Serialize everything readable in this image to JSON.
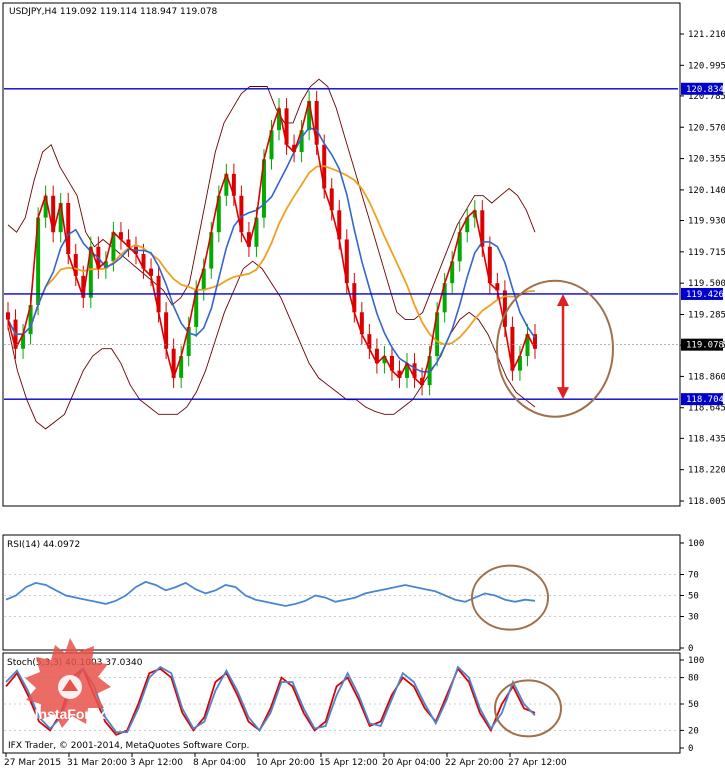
{
  "chart_data": [
    {
      "type": "line",
      "title": "USDJPY,H4  119.092 119.114 118.947 119.078",
      "ylim": [
        118.005,
        121.35
      ],
      "y_ticks": [
        "121.210",
        "120.995",
        "120.785",
        "120.570",
        "120.355",
        "120.140",
        "119.930",
        "119.715",
        "119.500",
        "119.285",
        "119.075",
        "118.860",
        "118.645",
        "118.435",
        "118.220",
        "118.005"
      ],
      "y_tick_values": [
        121.21,
        120.995,
        120.785,
        120.57,
        120.355,
        120.14,
        119.93,
        119.715,
        119.5,
        119.285,
        119.075,
        118.86,
        118.645,
        118.435,
        118.22,
        118.005
      ],
      "price_labels": [
        {
          "value": 120.834,
          "text": "120.834",
          "color": "#0000cc"
        },
        {
          "value": 119.426,
          "text": "119.426",
          "color": "#0000cc"
        },
        {
          "value": 119.078,
          "text": "119.078",
          "color": "#000000"
        },
        {
          "value": 118.704,
          "text": "118.704",
          "color": "#0000cc"
        }
      ],
      "x_labels": [
        "27 Mar 2015",
        "31 Mar 20:00",
        "3 Apr 12:00",
        "8 Apr 04:00",
        "10 Apr 20:00",
        "15 Apr 12:00",
        "20 Apr 04:00",
        "22 Apr 20:00",
        "27 Apr 12:00"
      ],
      "hlines": [
        120.834,
        119.426,
        118.704
      ],
      "close": [
        119.25,
        119.05,
        119.15,
        119.35,
        119.95,
        120.1,
        119.85,
        120.05,
        119.7,
        119.55,
        119.4,
        119.75,
        119.6,
        119.65,
        119.85,
        119.8,
        119.75,
        119.7,
        119.6,
        119.55,
        119.3,
        119.05,
        118.85,
        119.0,
        119.2,
        119.45,
        119.6,
        119.85,
        120.1,
        120.25,
        120.1,
        119.85,
        119.75,
        119.95,
        120.35,
        120.55,
        120.7,
        120.45,
        120.4,
        120.55,
        120.75,
        120.45,
        120.15,
        120.0,
        119.8,
        119.5,
        119.3,
        119.15,
        119.05,
        118.95,
        119.0,
        118.9,
        118.85,
        118.95,
        118.85,
        118.8,
        119.0,
        119.3,
        119.5,
        119.65,
        119.85,
        119.95,
        120.0,
        119.75,
        119.5,
        119.45,
        119.2,
        118.9,
        119.0,
        119.15,
        119.05
      ],
      "bb_upper": [
        119.9,
        119.85,
        119.95,
        120.2,
        120.4,
        120.45,
        120.3,
        120.2,
        120.1,
        119.85,
        119.75,
        119.8,
        119.75,
        119.7,
        119.65,
        119.6,
        119.55,
        119.5,
        119.45,
        119.35,
        119.4,
        119.5,
        119.8,
        120.1,
        120.4,
        120.6,
        120.7,
        120.8,
        120.85,
        120.85,
        120.85,
        120.7,
        120.6,
        120.6,
        120.75,
        120.85,
        120.9,
        120.85,
        120.7,
        120.5,
        120.3,
        120.1,
        119.9,
        119.7,
        119.5,
        119.3,
        119.25,
        119.25,
        119.3,
        119.45,
        119.6,
        119.75,
        119.9,
        120.0,
        120.1,
        120.1,
        120.05,
        120.1,
        120.15,
        120.1,
        120.0,
        119.85
      ],
      "bb_lower": [
        119.2,
        118.9,
        118.7,
        118.55,
        118.5,
        118.55,
        118.6,
        118.75,
        118.9,
        119.0,
        119.05,
        119.05,
        118.95,
        118.8,
        118.7,
        118.65,
        118.6,
        118.6,
        118.6,
        118.65,
        118.75,
        118.9,
        119.1,
        119.3,
        119.45,
        119.6,
        119.65,
        119.6,
        119.5,
        119.4,
        119.25,
        119.1,
        118.95,
        118.85,
        118.8,
        118.75,
        118.7,
        118.7,
        118.65,
        118.62,
        118.6,
        118.6,
        118.65,
        118.7,
        118.8,
        118.9,
        119.0,
        119.15,
        119.25,
        119.3,
        119.25,
        119.15,
        119.0,
        118.85,
        118.75,
        118.7,
        118.65
      ]
    },
    {
      "type": "line",
      "title": "RSI(14) 44.0972",
      "ylim": [
        0,
        100
      ],
      "y_ticks": [
        "100",
        "70",
        "50",
        "30",
        "0"
      ],
      "y_tick_values": [
        100,
        70,
        50,
        30,
        0
      ],
      "series": [
        {
          "name": "RSI(14)",
          "color": "#4a86d0",
          "values": [
            46,
            50,
            58,
            62,
            60,
            55,
            50,
            48,
            46,
            44,
            42,
            45,
            50,
            58,
            63,
            60,
            55,
            58,
            62,
            56,
            52,
            55,
            60,
            58,
            50,
            46,
            44,
            42,
            40,
            42,
            45,
            50,
            48,
            44,
            46,
            48,
            52,
            54,
            56,
            58,
            60,
            58,
            56,
            54,
            50,
            46,
            44,
            48,
            52,
            50,
            46,
            44,
            46,
            45
          ]
        }
      ]
    },
    {
      "type": "line",
      "title": "Stoch(5,3,3) 40.1003 37.0340",
      "ylim": [
        0,
        100
      ],
      "y_ticks": [
        "100",
        "80",
        "50",
        "20",
        "0"
      ],
      "y_tick_values": [
        100,
        80,
        50,
        20,
        0
      ],
      "series": [
        {
          "name": "Stoch main",
          "color": "#dd0000",
          "values": [
            70,
            85,
            60,
            30,
            20,
            40,
            80,
            90,
            60,
            30,
            15,
            20,
            50,
            85,
            90,
            80,
            40,
            20,
            35,
            75,
            85,
            60,
            30,
            20,
            45,
            80,
            70,
            40,
            20,
            30,
            70,
            80,
            55,
            25,
            30,
            60,
            80,
            70,
            45,
            30,
            60,
            90,
            75,
            40,
            20,
            50,
            70,
            45,
            40
          ]
        },
        {
          "name": "Stoch signal",
          "color": "#4a86d0",
          "values": [
            75,
            88,
            65,
            35,
            22,
            35,
            70,
            90,
            70,
            35,
            18,
            18,
            45,
            80,
            92,
            85,
            45,
            22,
            30,
            65,
            88,
            65,
            35,
            20,
            40,
            75,
            75,
            45,
            22,
            25,
            60,
            85,
            60,
            28,
            25,
            55,
            85,
            75,
            50,
            28,
            55,
            92,
            80,
            45,
            22,
            40,
            75,
            50,
            37
          ]
        }
      ]
    }
  ],
  "annotations": {
    "arrow_top": 119.426,
    "arrow_bottom": 118.704
  },
  "watermark": {
    "brand": "InstaForex",
    "credit": "IFX Trader, © 2001-2014, MetaQuotes Software Corp."
  },
  "colors": {
    "price_up": "#00aa00",
    "price_down": "#dd0000",
    "ma_blue": "#3366cc",
    "ma_orange": "#f0a020",
    "bands": "#6b0000",
    "hline": "#0000cc",
    "annotation": "#a0704a"
  }
}
